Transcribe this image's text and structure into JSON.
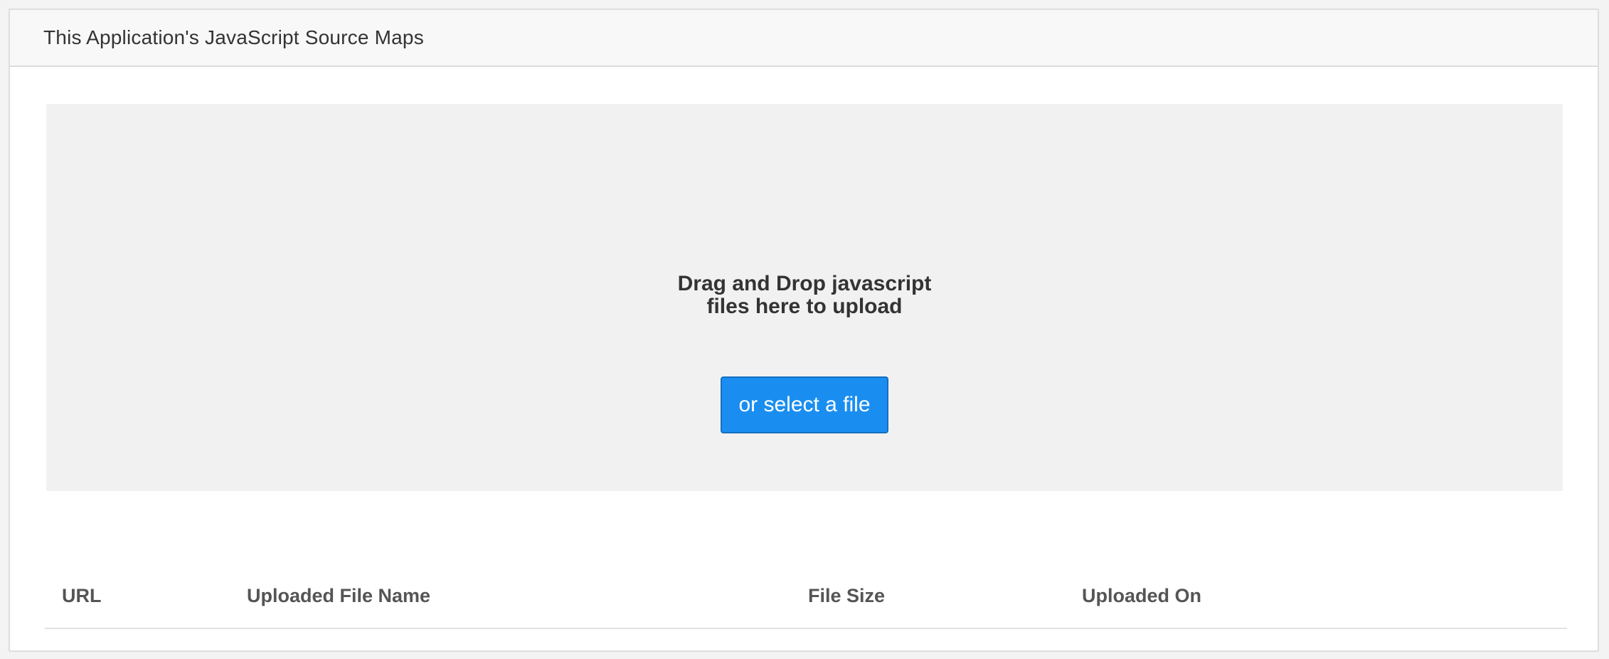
{
  "panel": {
    "title": "This Application's JavaScript Source Maps"
  },
  "dropzone": {
    "line1": "Drag and Drop javascript",
    "line2": "files here to upload",
    "select_label": "or select a file"
  },
  "table": {
    "columns": [
      "URL",
      "Uploaded File Name",
      "File Size",
      "Uploaded On"
    ]
  },
  "colors": {
    "accent": "#1a8ef0",
    "dropzone_bg": "#f1f1f1",
    "header_bg": "#f8f8f8"
  }
}
